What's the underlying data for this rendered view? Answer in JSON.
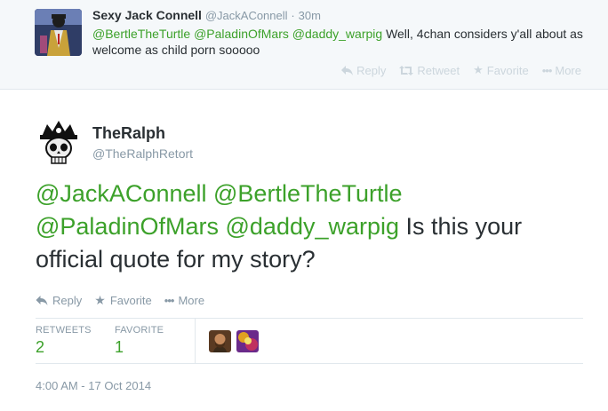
{
  "parent_tweet": {
    "name": "Sexy Jack Connell",
    "handle": "@JackAConnell",
    "separator": "·",
    "time": "30m",
    "mentions": [
      "@BertleTheTurtle",
      "@PaladinOfMars",
      "@daddy_warpig"
    ],
    "text": "Well, 4chan considers y'all about as welcome as child porn sooooo",
    "actions": {
      "reply": "Reply",
      "retweet": "Retweet",
      "favorite": "Favorite",
      "more": "More"
    }
  },
  "main_tweet": {
    "name": "TheRalph",
    "handle": "@TheRalphRetort",
    "mentions": [
      "@JackAConnell",
      "@BertleTheTurtle",
      "@PaladinOfMars",
      "@daddy_warpig"
    ],
    "text": "Is this your official quote for my story?",
    "actions": {
      "reply": "Reply",
      "favorite": "Favorite",
      "more": "More"
    },
    "stats": {
      "retweets_label": "RETWEETS",
      "retweets_value": "2",
      "favorites_label": "FAVORITE",
      "favorites_value": "1"
    },
    "timestamp": "4:00 AM - 17 Oct 2014"
  },
  "colors": {
    "accent_green": "#3ca12a",
    "muted_gray": "#8899a6",
    "text": "#292f33",
    "parent_bg": "#f5f8fa"
  },
  "icons": [
    "reply-icon",
    "retweet-icon",
    "favorite-star-icon",
    "more-dots-icon",
    "skull-crown-avatar-icon"
  ]
}
